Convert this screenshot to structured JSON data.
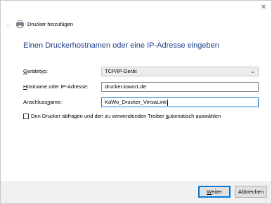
{
  "window": {
    "title": "Drucker hinzufügen",
    "close_glyph": "✕",
    "back_glyph": "←",
    "icons": [
      "back-arrow-icon",
      "printer-icon",
      "close-icon"
    ]
  },
  "page": {
    "heading": "Einen Druckerhostnamen oder eine IP-Adresse eingeben"
  },
  "form": {
    "device_type": {
      "label_pre": "",
      "label_accel": "G",
      "label_post": "erätetyp:",
      "value": "TCP/IP-Gerät",
      "chevron": "⌄"
    },
    "hostname": {
      "label_pre": "",
      "label_accel": "H",
      "label_post": "ostname oder IP-Adresse:",
      "value": "drucker.kawo1.de"
    },
    "port_name": {
      "label_pre": "Anschluss",
      "label_accel": "n",
      "label_post": "ame:",
      "value": "KaWo_Drucker_VersaLink"
    },
    "query_checkbox": {
      "label_pre": "Den Drucker abfragen und den zu verwendenden Treiber ",
      "label_accel": "a",
      "label_post": "utomatisch auswählen",
      "checked": false
    }
  },
  "footer": {
    "next": {
      "pre": "",
      "accel": "W",
      "post": "eiter"
    },
    "cancel": "Abbrechen"
  },
  "colors": {
    "heading": "#1c3f8a",
    "focus_border": "#1e79d6",
    "footer_bg": "#f0f0f0"
  }
}
